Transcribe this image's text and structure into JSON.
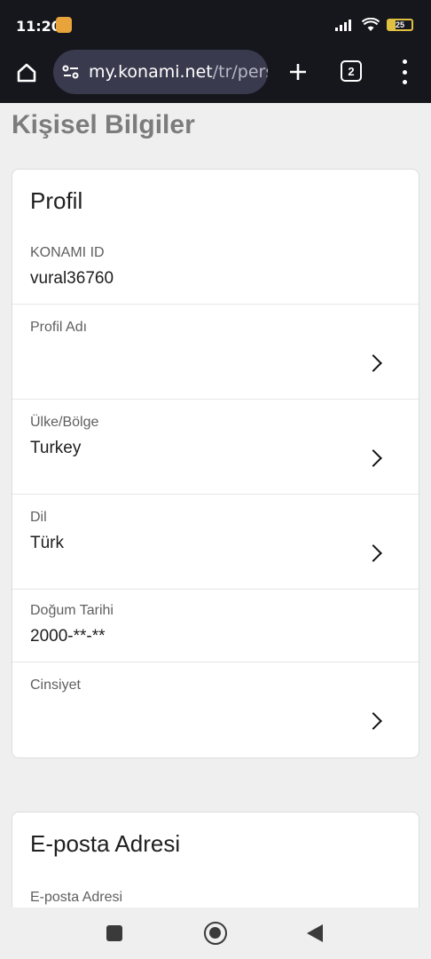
{
  "status_bar": {
    "time": "11:20",
    "battery_level": "25",
    "icons": [
      "avatar-emoji-icon",
      "signal-icon",
      "wifi-icon",
      "battery-icon"
    ]
  },
  "browser": {
    "url_host": "my.konami.net",
    "url_path": "/tr/pers",
    "tab_count": "2",
    "icons": [
      "home-icon",
      "site-settings-icon",
      "plus-icon",
      "tab-switcher-icon",
      "more-menu-icon"
    ]
  },
  "page": {
    "heading": "Kişisel Bilgiler"
  },
  "profile": {
    "title": "Profil",
    "rows": [
      {
        "label": "KONAMI ID",
        "value": "vural36760"
      },
      {
        "label": "Profil Adı",
        "value": ""
      },
      {
        "label": "Ülke/Bölge",
        "value": "Turkey"
      },
      {
        "label": "Dil",
        "value": "Türk"
      },
      {
        "label": "Doğum Tarihi",
        "value": "2000-**-**"
      },
      {
        "label": "Cinsiyet",
        "value": ""
      }
    ]
  },
  "email": {
    "title": "E-posta Adresi",
    "label": "E-posta Adresi"
  },
  "colors": {
    "system_bar": "#16161d",
    "url_pill": "#3a3a4e",
    "page_background": "#efefef",
    "card_background": "#ffffff",
    "heading_gray": "#7c7c7c",
    "battery_accent": "#e0c040"
  }
}
